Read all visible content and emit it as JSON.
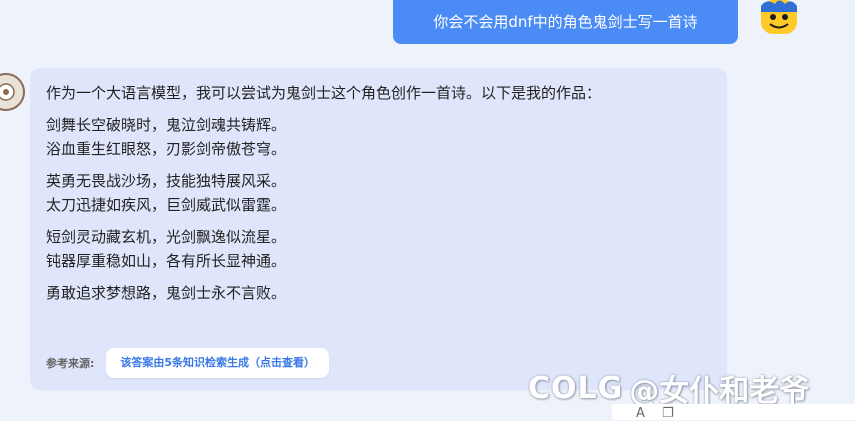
{
  "user_message": {
    "text": "你会不会用dnf中的角色鬼剑士写一首诗"
  },
  "bot_message": {
    "intro": "作为一个大语言模型，我可以尝试为鬼剑士这个角色创作一首诗。以下是我的作品：",
    "stanzas": [
      [
        "剑舞长空破晓时，鬼泣剑魂共铸辉。",
        "浴血重生红眼怒，刃影剑帝傲苍穹。"
      ],
      [
        "英勇无畏战沙场，技能独特展风采。",
        "太刀迅捷如疾风，巨剑威武似雷霆。"
      ],
      [
        "短剑灵动藏玄机，光剑飘逸似流星。",
        "钝器厚重稳如山，各有所长显神通。"
      ],
      [
        "勇敢追求梦想路，鬼剑士永不言败。"
      ]
    ],
    "source_label": "参考来源:",
    "source_button": "该答案由5条知识检索生成（点击查看）"
  },
  "watermark": {
    "logo": "COLG",
    "text": "@女仆和老爷"
  },
  "colors": {
    "user_bubble": "#4b8bf5",
    "bot_bubble": "#dfe6fc",
    "background": "#eef2fa",
    "link": "#3b78e7"
  },
  "icons": [
    "user-avatar-icon",
    "bot-avatar-icon",
    "font-size-icon",
    "copy-icon"
  ]
}
